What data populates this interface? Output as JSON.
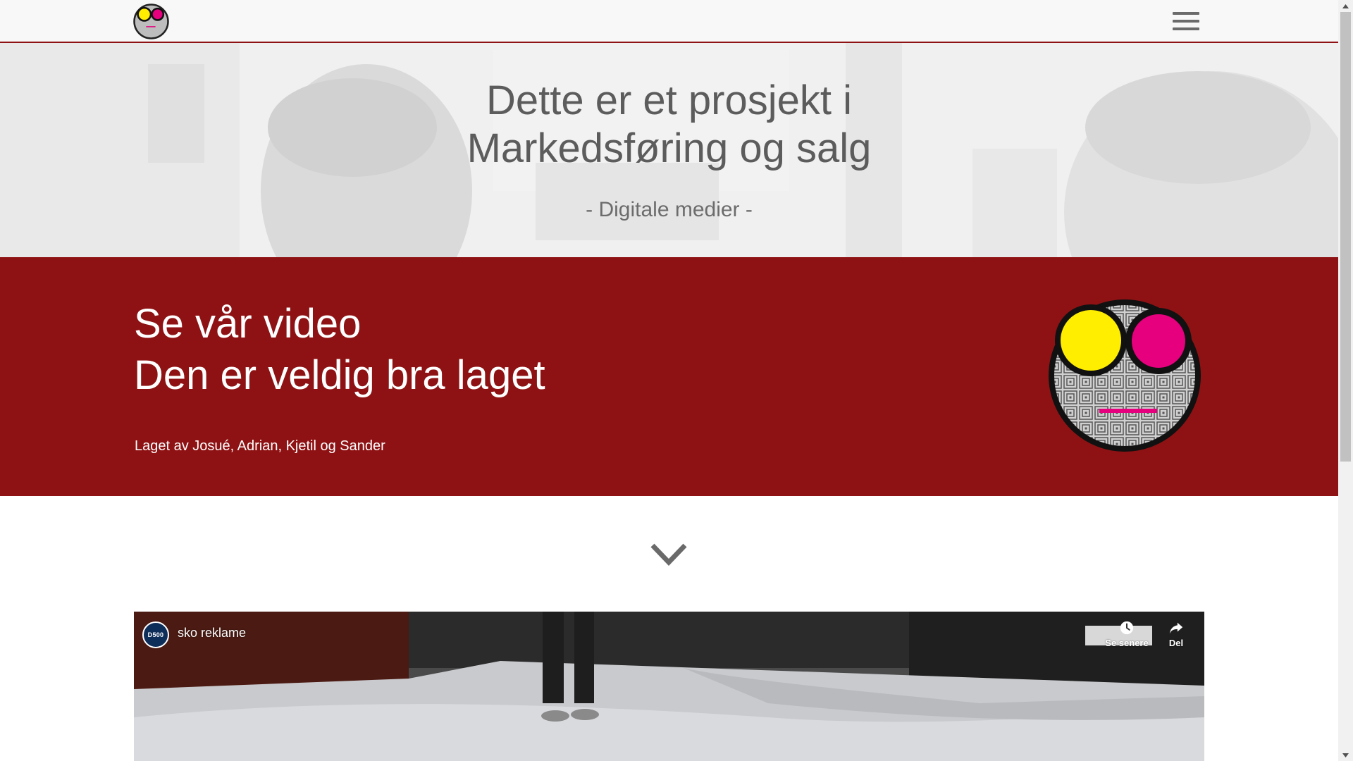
{
  "header": {
    "logo_alt": "logo",
    "menu_icon": "hamburger-menu-icon"
  },
  "hero": {
    "title_line1": "Dette er et prosjekt i",
    "title_line2": "Markedsføring og salg",
    "subtitle": "- Digitale medier -"
  },
  "feature": {
    "heading_line1": "Se vår video",
    "heading_line2": "Den er veldig bra laget",
    "credits": "Laget av Josué, Adrian, Kjetil og Sander"
  },
  "scroll_down_icon": "chevron-down-icon",
  "video": {
    "channel_badge": "D500",
    "title": "sko reklame",
    "watch_later_label": "Se senere",
    "share_label": "Del"
  },
  "colors": {
    "accent_red": "#8e1214",
    "logo_yellow": "#ffee00",
    "logo_magenta": "#e6007e",
    "header_bg": "#f8f8f8"
  }
}
